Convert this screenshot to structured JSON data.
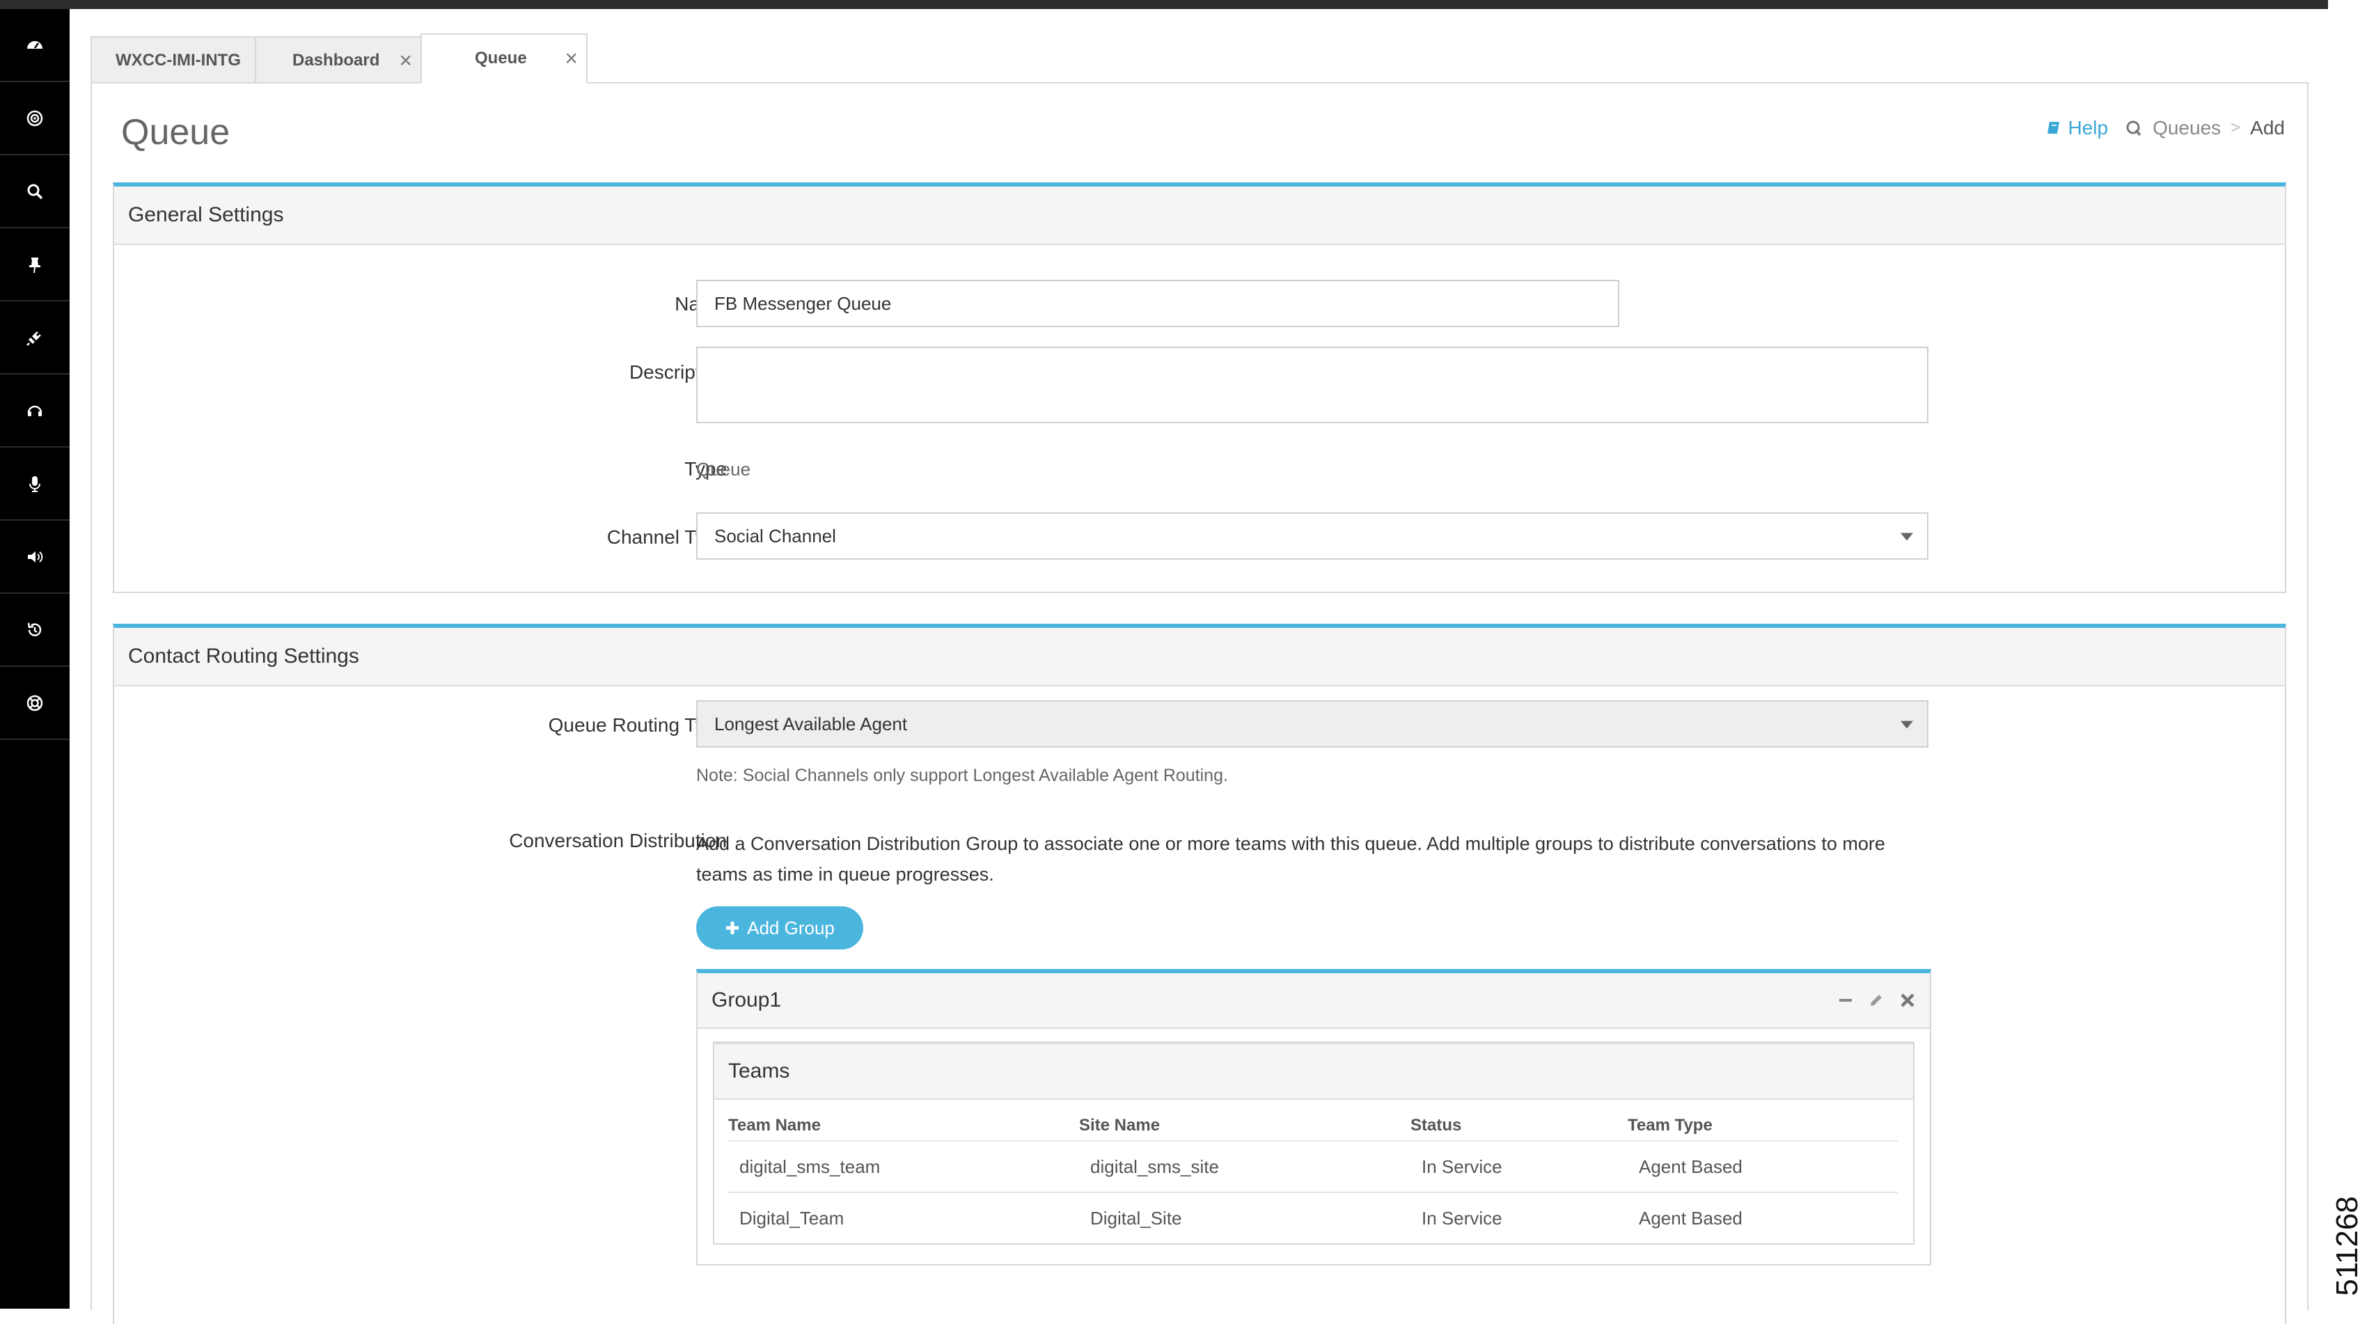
{
  "sidebar": {
    "items": [
      {
        "icon": "dashboard-icon"
      },
      {
        "icon": "target-icon"
      },
      {
        "icon": "search-icon"
      },
      {
        "icon": "pin-icon"
      },
      {
        "icon": "plug-icon"
      },
      {
        "icon": "headset-icon"
      },
      {
        "icon": "microphone-icon"
      },
      {
        "icon": "volume-icon"
      },
      {
        "icon": "history-icon"
      },
      {
        "icon": "support-icon"
      }
    ]
  },
  "tabs": [
    {
      "label": "WXCC-IMI-INTG",
      "closable": false
    },
    {
      "label": "Dashboard",
      "closable": true,
      "close": "×"
    },
    {
      "label": "Queue",
      "closable": true,
      "close": "×",
      "active": true
    }
  ],
  "page": {
    "title": "Queue",
    "breadcrumb": {
      "help": "Help",
      "queues": "Queues",
      "separator": ">",
      "current": "Add"
    }
  },
  "general": {
    "header": "General Settings",
    "name_label": "Name",
    "name_value": "FB Messenger Queue",
    "description_label": "Description",
    "description_value": "",
    "type_label": "Type",
    "type_value": "Queue",
    "channel_type_label": "Channel Type",
    "channel_type_value": "Social Channel"
  },
  "routing": {
    "header": "Contact Routing Settings",
    "routing_type_label": "Queue Routing Type",
    "routing_type_value": "Longest Available Agent",
    "note": "Note: Social Channels only support Longest Available Agent Routing.",
    "distribution_label": "Conversation Distribution",
    "distribution_text_line1": "Add a Conversation Distribution Group to associate one or more teams with this queue. Add multiple groups to distribute conversations to more",
    "distribution_text_line2": "teams as time in queue progresses.",
    "add_group_label": "Add Group",
    "group": {
      "title": "Group1",
      "teams_header": "Teams",
      "columns": [
        "Team Name",
        "Site Name",
        "Status",
        "Team Type"
      ],
      "rows": [
        [
          "digital_sms_team",
          "digital_sms_site",
          "In Service",
          "Agent Based"
        ],
        [
          "Digital_Team",
          "Digital_Site",
          "In Service",
          "Agent Based"
        ]
      ]
    }
  },
  "figure_id": "511268",
  "colors": {
    "accent": "#4ab6de",
    "sidebar": "#000000",
    "topbar": "#2d2d2d"
  }
}
